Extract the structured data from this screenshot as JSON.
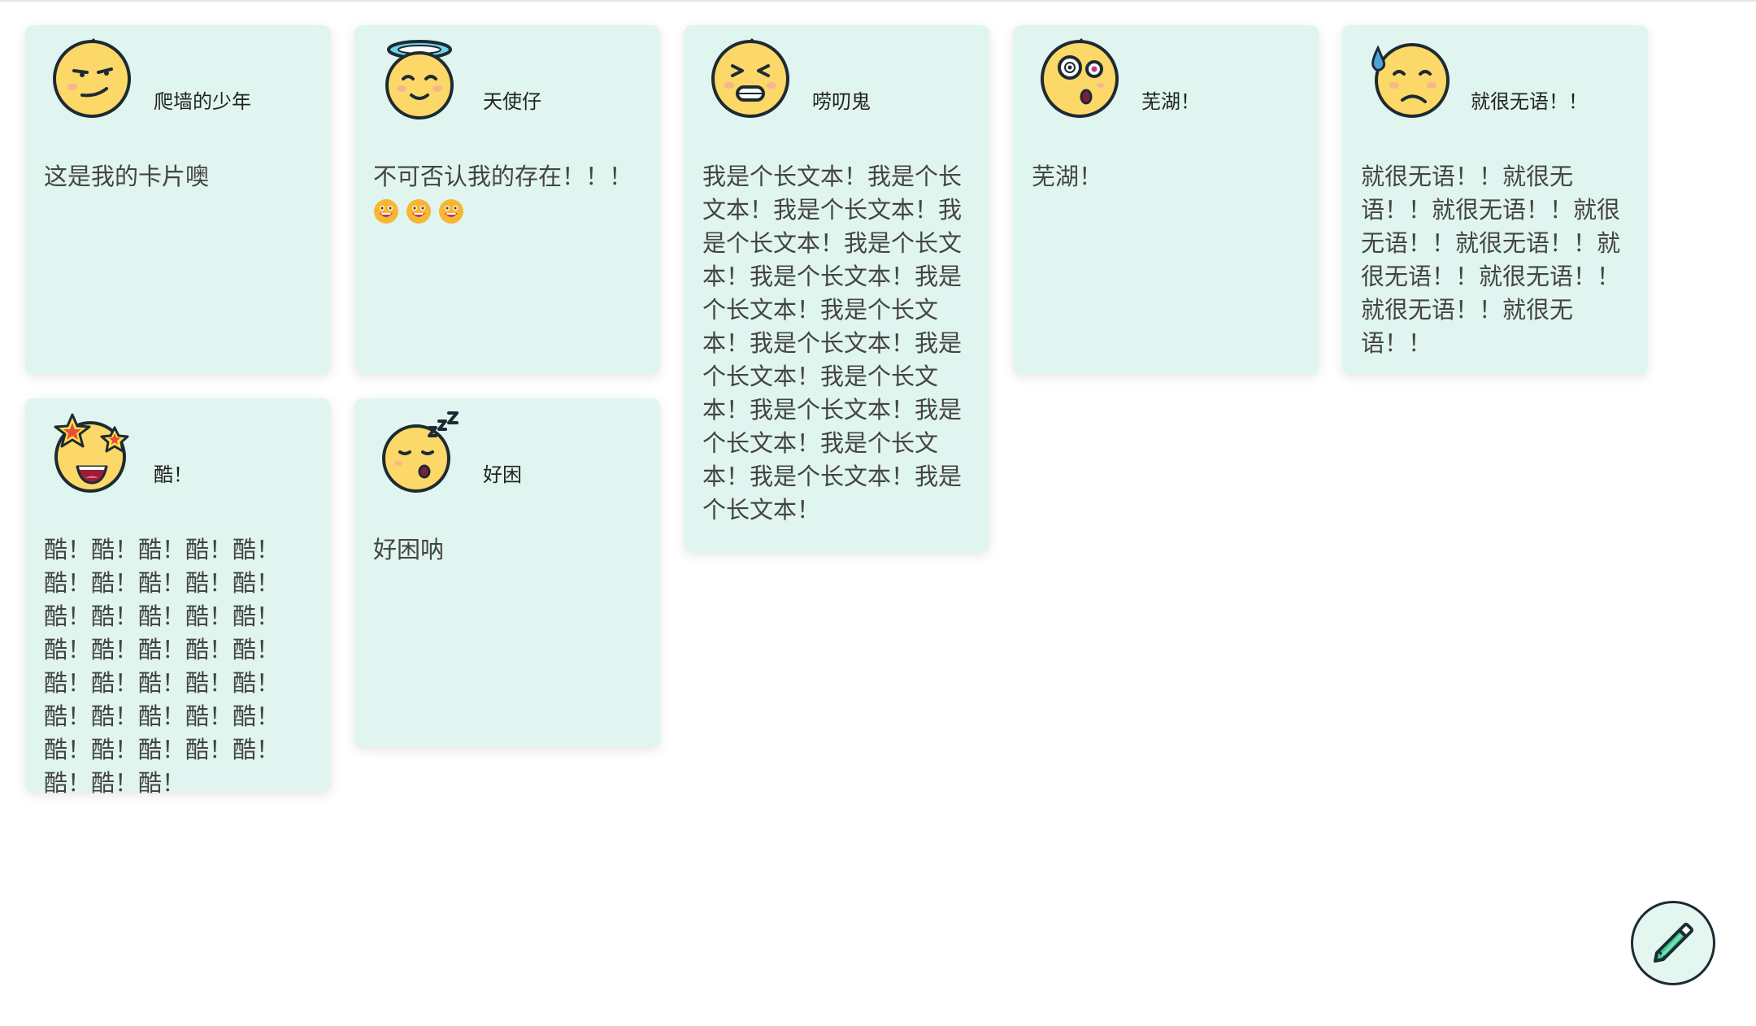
{
  "cards": [
    {
      "name": "爬墙的少年",
      "text": "这是我的卡片噢",
      "avatar": "smirk-face-icon"
    },
    {
      "name": "天使仔",
      "text": "不可否认我的存在！！！",
      "avatar": "angel-face-icon",
      "trailing_emojis": [
        "grin-emoji",
        "grin-emoji",
        "grin-emoji"
      ]
    },
    {
      "name": "唠叨鬼",
      "text": "我是个长文本！我是个长文本！我是个长文本！我是个长文本！我是个长文本！我是个长文本！我是个长文本！我是个长文本！我是个长文本！我是个长文本！我是个长文本！我是个长文本！我是个长文本！我是个长文本！我是个长文本！我是个长文本！",
      "avatar": "squint-grimace-face-icon"
    },
    {
      "name": "芜湖！",
      "text": "芜湖！",
      "avatar": "dizzy-face-icon"
    },
    {
      "name": "就很无语！！",
      "text": "就很无语！！就很无语！！就很无语！！就很无语！！就很无语！！就很无语！！就很无语！！就很无语！！就很无语！！",
      "avatar": "sweat-face-icon"
    },
    {
      "name": "酷！",
      "text": "酷！酷！酷！酷！酷！酷！酷！酷！酷！酷！酷！酷！酷！酷！酷！酷！酷！酷！酷！酷！酷！酷！酷！酷！酷！酷！酷！酷！酷！酷！酷！酷！酷！酷！酷！酷！酷！酷！",
      "avatar": "star-eyes-face-icon"
    },
    {
      "name": "好困",
      "text": "好困呐",
      "avatar": "sleepy-face-icon"
    }
  ],
  "fab": {
    "icon": "pencil-edit-icon"
  },
  "colors": {
    "card_bg": "#e0f5ef",
    "face_yellow": "#fcd868",
    "outline": "#1e2a33",
    "accent_green": "#3ecf8e"
  }
}
